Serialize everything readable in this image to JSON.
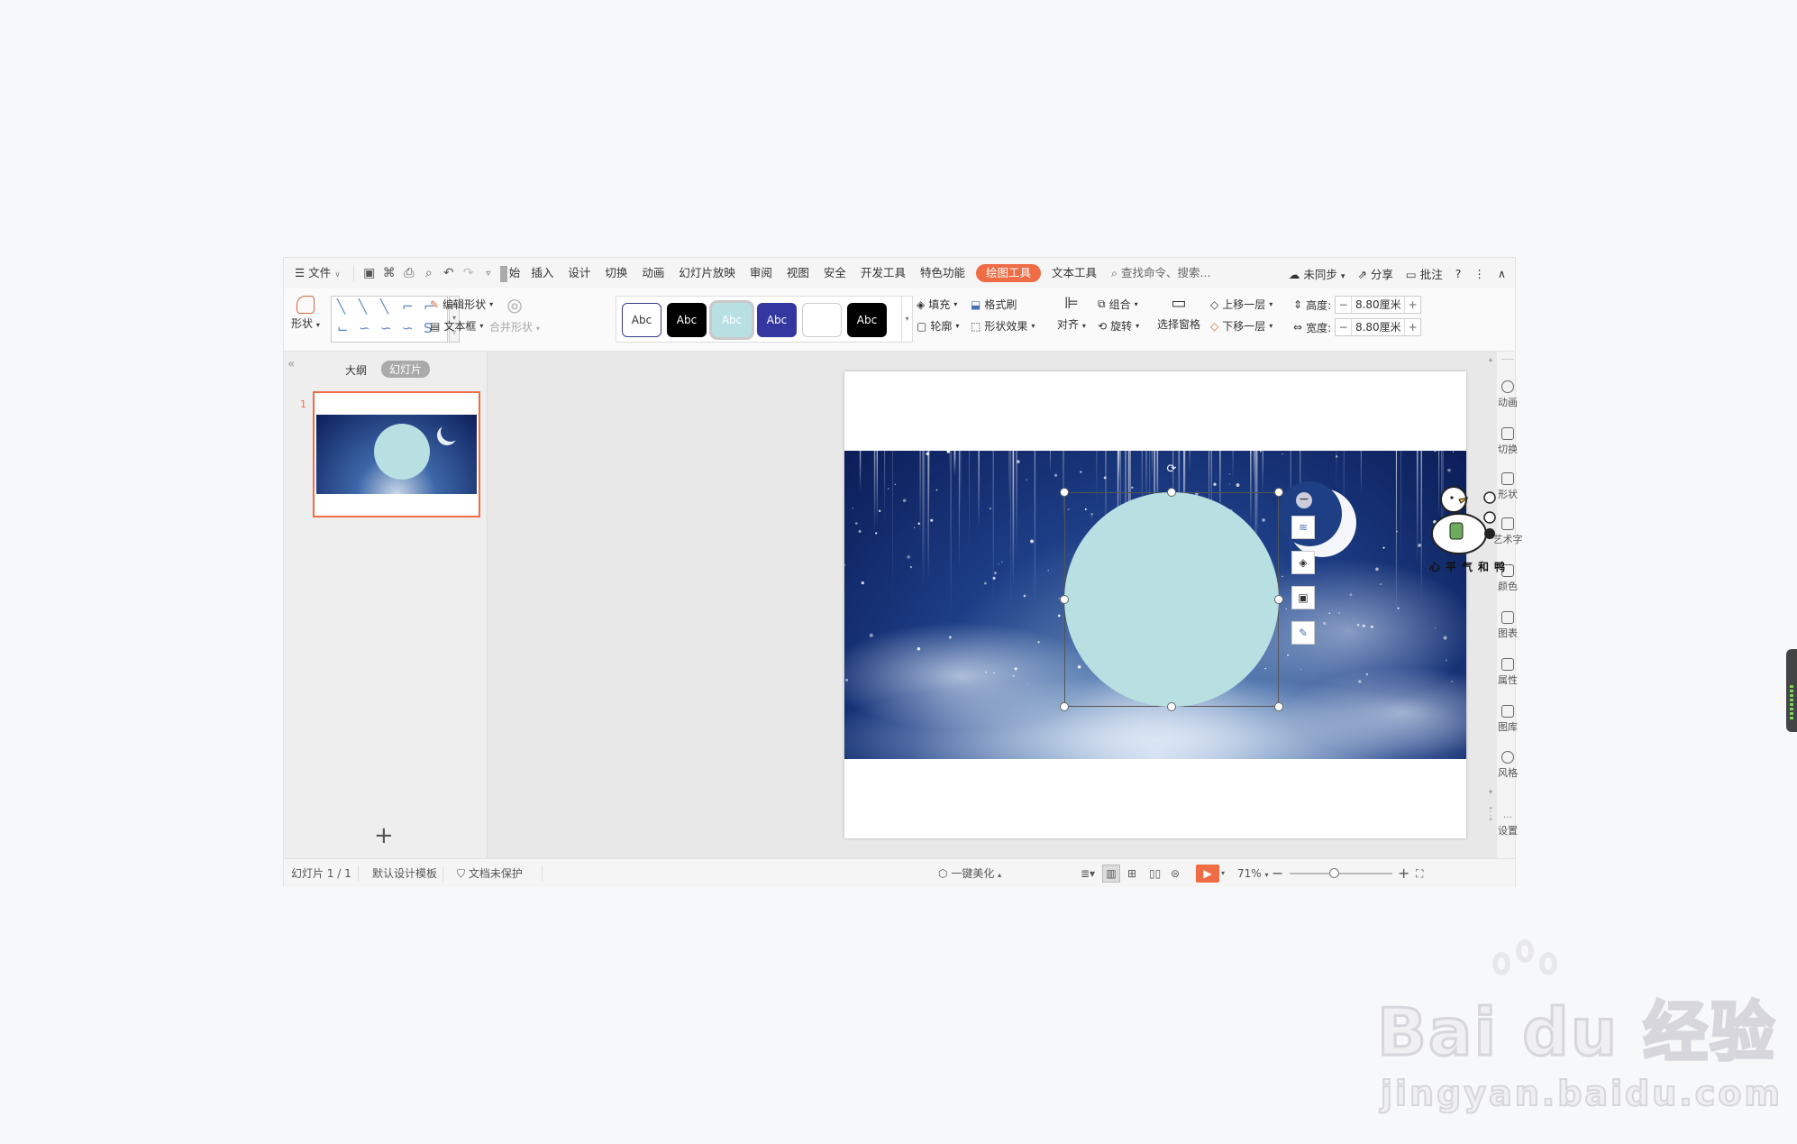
{
  "menubar": {
    "file_label": "文件",
    "tabs": [
      "始",
      "插入",
      "设计",
      "切换",
      "动画",
      "幻灯片放映",
      "审阅",
      "视图",
      "安全",
      "开发工具",
      "特色功能",
      "绘图工具",
      "文本工具"
    ],
    "search_label": "查找命令、搜索...",
    "sync_label": "未同步",
    "share_label": "分享",
    "comment_label": "批注",
    "help_label": "?"
  },
  "ribbon": {
    "shape_label": "形状",
    "edit_shape_label": "编辑形状",
    "textbox_label": "文本框",
    "merge_label": "合并形状",
    "style_swatches": [
      {
        "label": "Abc",
        "bg": "#ffffff",
        "fg": "#333333",
        "border": "#3b3a8c"
      },
      {
        "label": "Abc",
        "bg": "#000000",
        "fg": "#ffffff",
        "border": "#000000"
      },
      {
        "label": "Abc",
        "bg": "#b8e0e2",
        "fg": "#ffffff",
        "border": "#9fc9cc"
      },
      {
        "label": "Abc",
        "bg": "#3437a0",
        "fg": "#ffffff",
        "border": "#3437a0"
      },
      {
        "label": "",
        "bg": "#ffffff",
        "fg": "#333333",
        "border": "#cccccc"
      },
      {
        "label": "Abc",
        "bg": "#000000",
        "fg": "#ffffff",
        "border": "#000000"
      }
    ],
    "fill_label": "填充",
    "format_painter_label": "格式刷",
    "outline_label": "轮廓",
    "effects_label": "形状效果",
    "align_label": "对齐",
    "group_label": "组合",
    "rotate_label": "旋转",
    "selection_pane_label": "选择窗格",
    "bring_forward_label": "上移一层",
    "send_backward_label": "下移一层",
    "height_label": "高度:",
    "height_value": "8.80厘米",
    "width_label": "宽度:",
    "width_value": "8.80厘米"
  },
  "left_panel": {
    "outline_tab": "大纲",
    "slides_tab": "幻灯片",
    "slide_number": "1",
    "add_label": "+",
    "collapse": "«"
  },
  "right_panel": {
    "items": [
      "动画",
      "切换",
      "形状",
      "艺术字",
      "颜色",
      "图表",
      "属性",
      "图库",
      "风格",
      "设置"
    ]
  },
  "sticker_text": "心平气和鸭",
  "status": {
    "slide_info": "幻灯片 1 / 1",
    "template": "默认设计模板",
    "protection": "文档未保护",
    "beautify": "一键美化",
    "zoom": "71%"
  },
  "watermark": {
    "brand": "Bai du 经验",
    "url": "jingyan.baidu.com"
  },
  "colors": {
    "accent": "#ef6c45",
    "circle_fill": "#b8dfe2"
  }
}
